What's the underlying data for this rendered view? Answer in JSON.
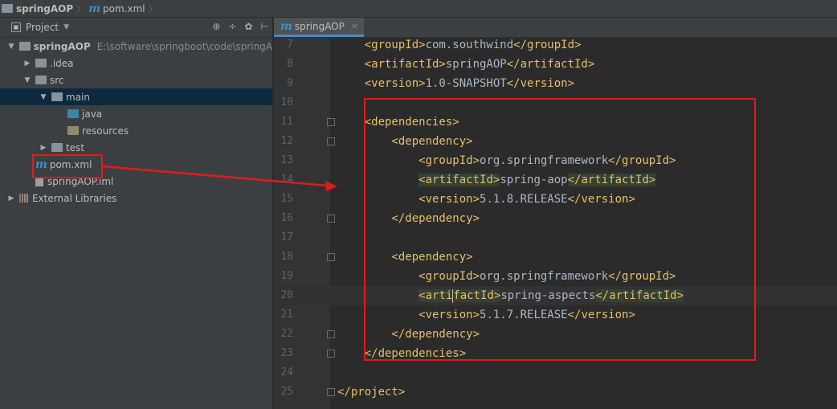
{
  "breadcrumb": {
    "project": "springAOP",
    "file": "pom.xml"
  },
  "sidebar": {
    "header_label": "Project",
    "tools": [
      "⊕",
      "÷",
      "✿",
      "⊢"
    ],
    "tree": [
      {
        "label": "springAOP",
        "path": "E:\\software\\springboot\\code\\springA",
        "arrow": "▼",
        "indent": 0,
        "kind": "module"
      },
      {
        "label": ".idea",
        "arrow": "▶",
        "indent": 1,
        "kind": "folder"
      },
      {
        "label": "src",
        "arrow": "▼",
        "indent": 1,
        "kind": "folder"
      },
      {
        "label": "main",
        "arrow": "▼",
        "indent": 2,
        "kind": "folder",
        "selected": true
      },
      {
        "label": "java",
        "arrow": "",
        "indent": 3,
        "kind": "folder-blue"
      },
      {
        "label": "resources",
        "arrow": "",
        "indent": 3,
        "kind": "folder-res"
      },
      {
        "label": "test",
        "arrow": "▶",
        "indent": 2,
        "kind": "folder"
      },
      {
        "label": "pom.xml",
        "arrow": "",
        "indent": 1,
        "kind": "maven"
      },
      {
        "label": "springAOP.iml",
        "arrow": "",
        "indent": 1,
        "kind": "file"
      },
      {
        "label": "External Libraries",
        "arrow": "▶",
        "indent": 0,
        "kind": "lib"
      }
    ]
  },
  "editor": {
    "tab_label": "springAOP",
    "tab_close": "×",
    "lines": [
      {
        "n": "7",
        "parts": [
          [
            "tag",
            "    <groupId>"
          ],
          [
            "txt",
            "com.southwind"
          ],
          [
            "tag",
            "</groupId>"
          ]
        ]
      },
      {
        "n": "8",
        "parts": [
          [
            "tag",
            "    <artifactId>"
          ],
          [
            "txt",
            "springAOP"
          ],
          [
            "tag",
            "</artifactId>"
          ]
        ]
      },
      {
        "n": "9",
        "parts": [
          [
            "tag",
            "    <version>"
          ],
          [
            "txt",
            "1.0-SNAPSHOT"
          ],
          [
            "tag",
            "</version>"
          ]
        ]
      },
      {
        "n": "10",
        "parts": []
      },
      {
        "n": "11",
        "parts": [
          [
            "tag",
            "    <dependencies>"
          ]
        ],
        "fold": true
      },
      {
        "n": "12",
        "parts": [
          [
            "tag",
            "        <dependency>"
          ]
        ],
        "fold": true
      },
      {
        "n": "13",
        "parts": [
          [
            "tag",
            "            <groupId>"
          ],
          [
            "txt",
            "org.springframework"
          ],
          [
            "tag",
            "</groupId>"
          ]
        ]
      },
      {
        "n": "14",
        "parts": [
          [
            "tag",
            "            "
          ],
          [
            "hltag",
            "<artifactId>"
          ],
          [
            "txt",
            "spring-aop"
          ],
          [
            "hltag",
            "</artifactId>"
          ]
        ]
      },
      {
        "n": "15",
        "parts": [
          [
            "tag",
            "            <version>"
          ],
          [
            "txt",
            "5.1.8.RELEASE"
          ],
          [
            "tag",
            "</version>"
          ]
        ]
      },
      {
        "n": "16",
        "parts": [
          [
            "tag",
            "        </dependency>"
          ]
        ],
        "fold": true
      },
      {
        "n": "17",
        "parts": []
      },
      {
        "n": "18",
        "parts": [
          [
            "tag",
            "        <dependency>"
          ]
        ],
        "fold": true
      },
      {
        "n": "19",
        "parts": [
          [
            "tag",
            "            <groupId>"
          ],
          [
            "txt",
            "org.springframework"
          ],
          [
            "tag",
            "</groupId>"
          ]
        ]
      },
      {
        "n": "20",
        "parts": [
          [
            "tag",
            "            "
          ],
          [
            "hltag",
            "<arti"
          ],
          [
            "caret",
            ""
          ],
          [
            "hltag",
            "factId>"
          ],
          [
            "txt",
            "spring-aspects"
          ],
          [
            "hltag",
            "</artifactId>"
          ]
        ],
        "current": true
      },
      {
        "n": "21",
        "parts": [
          [
            "tag",
            "            <version>"
          ],
          [
            "txt",
            "5.1.7.RELEASE"
          ],
          [
            "tag",
            "</version>"
          ]
        ]
      },
      {
        "n": "22",
        "parts": [
          [
            "tag",
            "        </dependency>"
          ]
        ],
        "fold": true
      },
      {
        "n": "23",
        "parts": [
          [
            "tag",
            "    </dependencies>"
          ]
        ],
        "fold": true
      },
      {
        "n": "24",
        "parts": []
      },
      {
        "n": "25",
        "parts": [
          [
            "tag",
            "</project>"
          ]
        ],
        "fold": true
      }
    ]
  },
  "colors": {
    "annotation": "#e11b1b",
    "tag": "#e8bf6a",
    "text": "#a9b7c6"
  }
}
